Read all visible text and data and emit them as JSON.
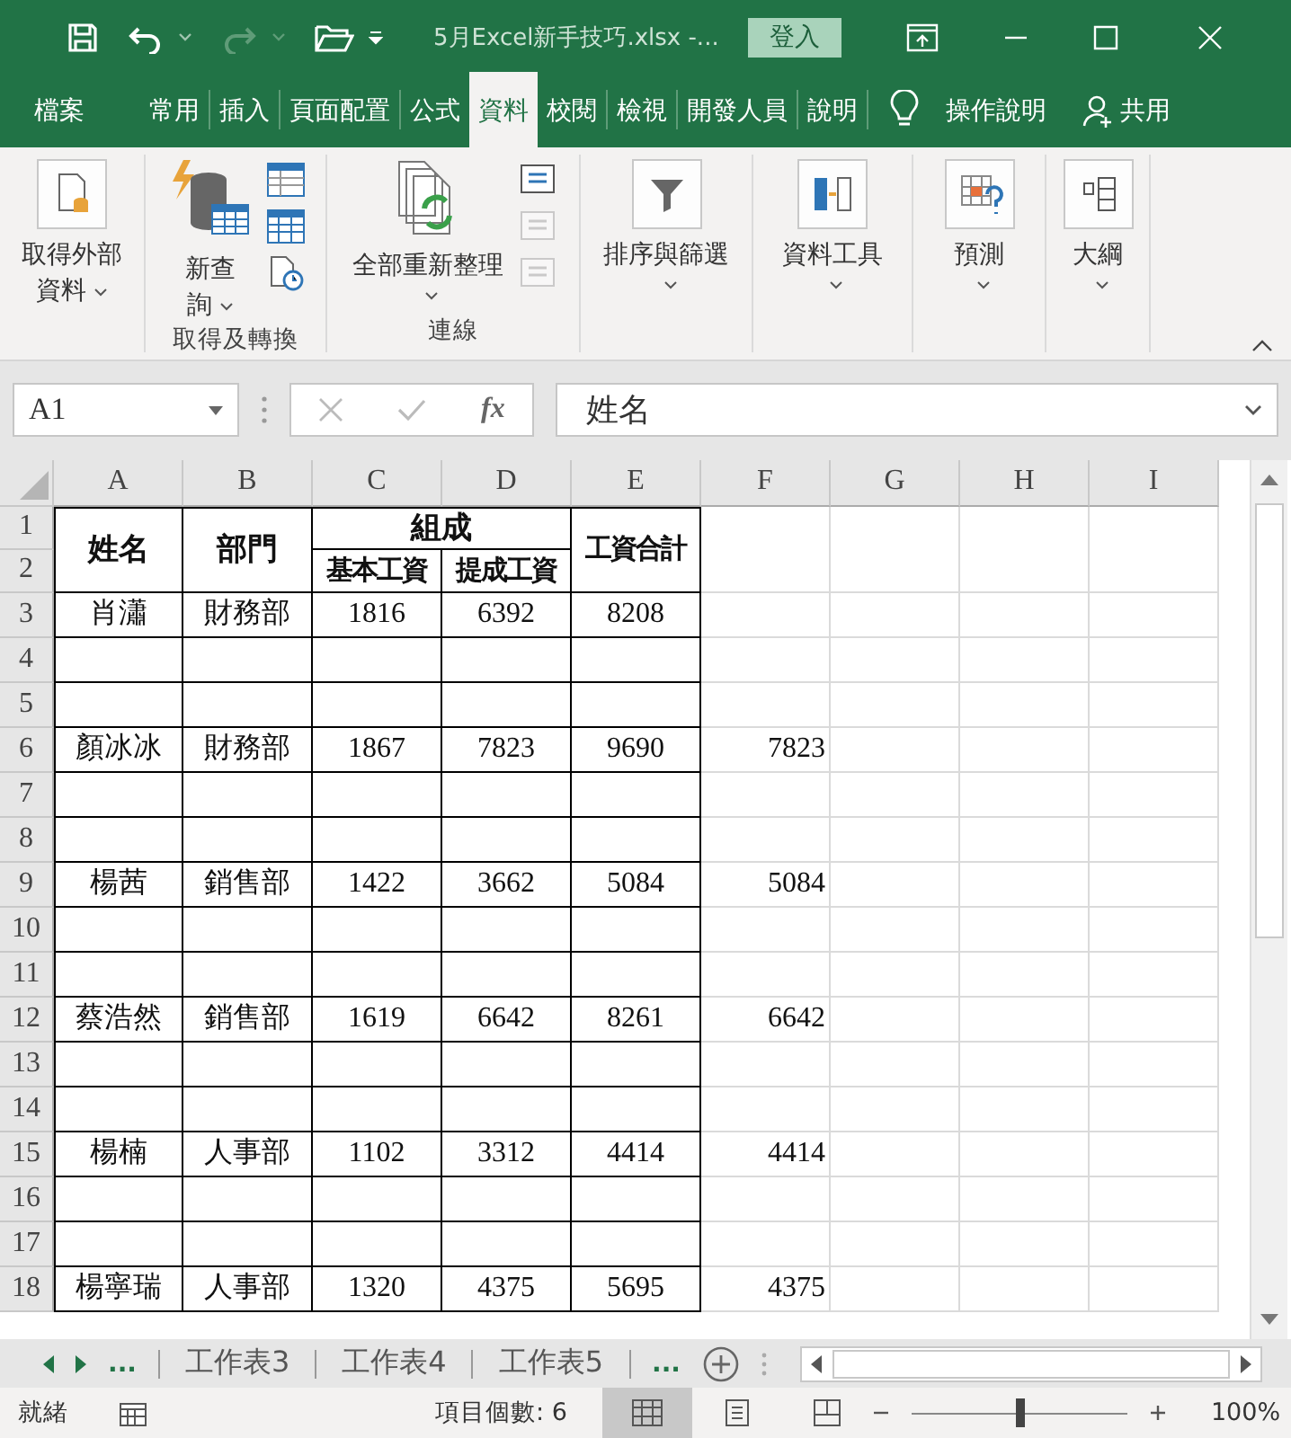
{
  "window": {
    "title": "5月Excel新手技巧.xlsx  -...",
    "sign_in": "登入",
    "redo_disabled": true
  },
  "tabs": [
    {
      "label": "檔案",
      "selected": false
    },
    {
      "label": "常用",
      "selected": false
    },
    {
      "label": "插入",
      "selected": false
    },
    {
      "label": "頁面配置",
      "selected": false
    },
    {
      "label": "公式",
      "selected": false
    },
    {
      "label": "資料",
      "selected": true
    },
    {
      "label": "校閱",
      "selected": false
    },
    {
      "label": "檢視",
      "selected": false
    },
    {
      "label": "開發人員",
      "selected": false
    },
    {
      "label": "說明",
      "selected": false
    }
  ],
  "tell_me": "操作說明",
  "share": "共用",
  "ribbon": {
    "get_external": "取得外部資料",
    "new_query": "新查詢",
    "get_transform": "取得及轉換",
    "refresh_all": "全部重新整理",
    "connections": "連線",
    "connection_tools": [
      {
        "disabled": false
      },
      {
        "disabled": true
      },
      {
        "disabled": true
      }
    ],
    "sort_filter": "排序與篩選",
    "data_tools": "資料工具",
    "forecast": "預測",
    "outline": "大綱"
  },
  "formula_bar": {
    "name_box": "A1",
    "function_label": "fx",
    "value": "姓名"
  },
  "columns": [
    "A",
    "B",
    "C",
    "D",
    "E",
    "F",
    "G",
    "H",
    "I"
  ],
  "header": {
    "rows": [
      "1",
      "2"
    ],
    "name": "姓名",
    "dept": "部門",
    "group": "組成",
    "base": "基本工資",
    "bonus": "提成工資",
    "total": "工資合計"
  },
  "rows": [
    {
      "number": "3",
      "cells": {
        "A": "肖瀟",
        "B": "財務部",
        "C": "1816",
        "D": "6392",
        "E": "8208"
      }
    },
    {
      "number": "4",
      "cells": {}
    },
    {
      "number": "5",
      "cells": {}
    },
    {
      "number": "6",
      "cells": {
        "A": "顏冰冰",
        "B": "財務部",
        "C": "1867",
        "D": "7823",
        "E": "9690",
        "F": "7823"
      }
    },
    {
      "number": "7",
      "cells": {}
    },
    {
      "number": "8",
      "cells": {}
    },
    {
      "number": "9",
      "cells": {
        "A": "楊茜",
        "B": "銷售部",
        "C": "1422",
        "D": "3662",
        "E": "5084",
        "F": "5084"
      }
    },
    {
      "number": "10",
      "cells": {}
    },
    {
      "number": "11",
      "cells": {}
    },
    {
      "number": "12",
      "cells": {
        "A": "蔡浩然",
        "B": "銷售部",
        "C": "1619",
        "D": "6642",
        "E": "8261",
        "F": "6642"
      }
    },
    {
      "number": "13",
      "cells": {}
    },
    {
      "number": "14",
      "cells": {}
    },
    {
      "number": "15",
      "cells": {
        "A": "楊楠",
        "B": "人事部",
        "C": "1102",
        "D": "3312",
        "E": "4414",
        "F": "4414"
      }
    },
    {
      "number": "16",
      "cells": {}
    },
    {
      "number": "17",
      "cells": {}
    },
    {
      "number": "18",
      "cells": {
        "A": "楊寧瑞",
        "B": "人事部",
        "C": "1320",
        "D": "4375",
        "E": "5695",
        "F": "4375"
      }
    }
  ],
  "sheet_tabs": {
    "more_left": "...",
    "tabs": [
      {
        "label": "工作表3",
        "selected": false
      },
      {
        "label": "工作表4",
        "selected": false
      },
      {
        "label": "工作表5",
        "selected": false
      }
    ],
    "more_right": "..."
  },
  "status_bar": {
    "ready": "就緒",
    "count": "項目個數: 6",
    "views": [
      {
        "selected": true
      },
      {
        "selected": false
      },
      {
        "selected": false
      }
    ],
    "zoom_slider": {
      "level": 0.5
    },
    "zoom": "100%"
  }
}
